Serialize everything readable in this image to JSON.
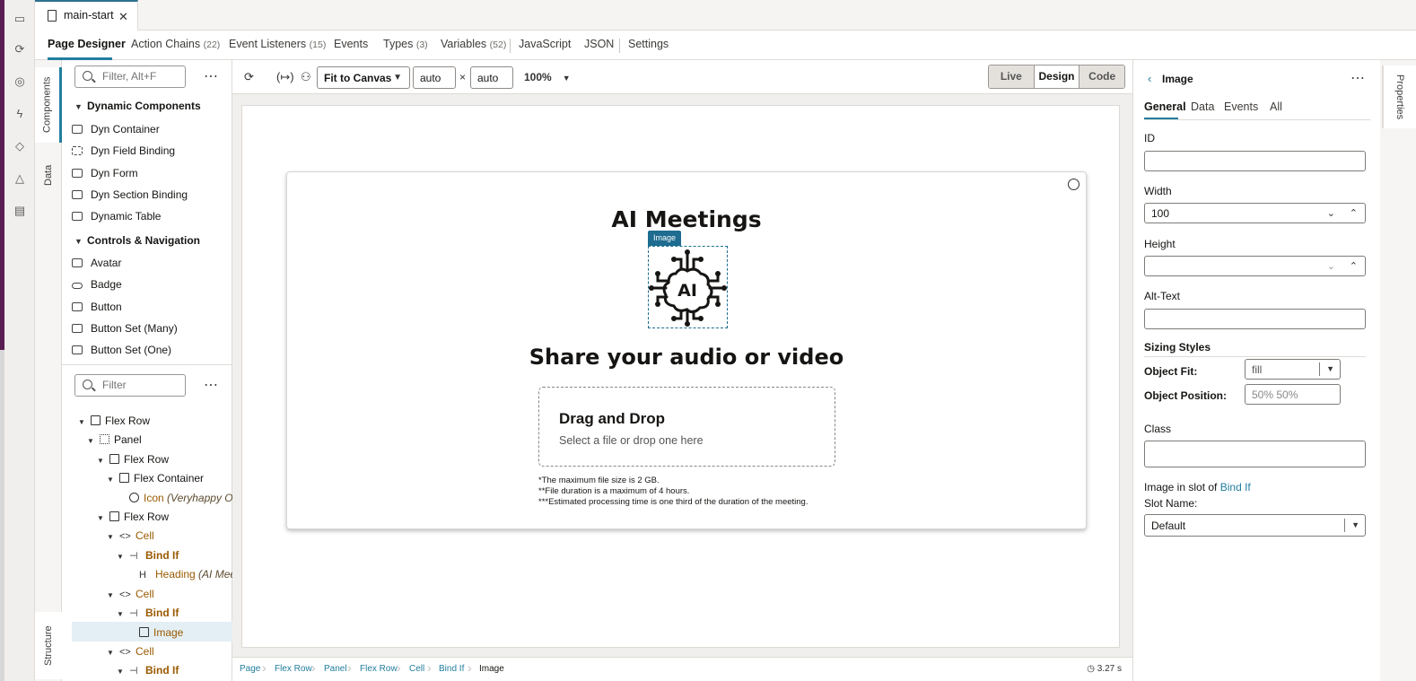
{
  "file_tab": {
    "name": "main-start"
  },
  "nav_tabs": [
    {
      "label": "Page Designer",
      "count": ""
    },
    {
      "label": "Action Chains",
      "count": "(22)"
    },
    {
      "label": "Event Listeners",
      "count": "(15)"
    },
    {
      "label": "Events",
      "count": ""
    },
    {
      "label": "Types",
      "count": "(3)"
    },
    {
      "label": "Variables",
      "count": "(52)"
    },
    {
      "label": "JavaScript",
      "count": ""
    },
    {
      "label": "JSON",
      "count": ""
    },
    {
      "label": "Settings",
      "count": ""
    }
  ],
  "left_tabs": {
    "components": "Components",
    "data": "Data",
    "structure": "Structure"
  },
  "components": {
    "filter_placeholder": "Filter, Alt+F",
    "groups": [
      {
        "title": "Dynamic Components",
        "items": [
          "Dyn Container",
          "Dyn Field Binding",
          "Dyn Form",
          "Dyn Section Binding",
          "Dynamic Table"
        ]
      },
      {
        "title": "Controls & Navigation",
        "items": [
          "Avatar",
          "Badge",
          "Button",
          "Button Set (Many)",
          "Button Set (One)"
        ]
      }
    ]
  },
  "structure": {
    "filter_placeholder": "Filter",
    "nodes": [
      {
        "label": "Flex Row",
        "sub": ""
      },
      {
        "label": "Panel",
        "sub": ""
      },
      {
        "label": "Flex Row",
        "sub": ""
      },
      {
        "label": "Flex Container",
        "sub": ""
      },
      {
        "label": "Icon",
        "sub": "(Veryhappy Ou"
      },
      {
        "label": "Flex Row",
        "sub": ""
      },
      {
        "label": "Cell",
        "sub": ""
      },
      {
        "label": "Bind If",
        "sub": ""
      },
      {
        "label": "Heading",
        "sub": "(AI Meet"
      },
      {
        "label": "Cell",
        "sub": ""
      },
      {
        "label": "Bind If",
        "sub": ""
      },
      {
        "label": "Image",
        "sub": ""
      },
      {
        "label": "Cell",
        "sub": ""
      },
      {
        "label": "Bind If",
        "sub": ""
      }
    ]
  },
  "toolbar": {
    "fit": "Fit to Canvas",
    "width": "auto",
    "times": "×",
    "height": "auto",
    "zoom": "100%",
    "modes": [
      "Live",
      "Design",
      "Code"
    ]
  },
  "canvas": {
    "title": "AI Meetings",
    "image_badge": "Image",
    "image_text": "AI",
    "share": "Share your audio or video",
    "drop_title": "Drag and Drop",
    "drop_sub": "Select a file or drop one here",
    "notes": [
      "*The maximum file size is 2 GB.",
      "**File duration is a maximum of 4 hours.",
      "***Estimated processing time is one third of the duration of the meeting."
    ]
  },
  "breadcrumb": [
    "Page",
    "Flex Row",
    "Panel",
    "Flex Row",
    "Cell",
    "Bind If",
    "Image"
  ],
  "timer": "3.27 s",
  "properties": {
    "vertical_tab": "Properties",
    "title": "Image",
    "tabs": [
      "General",
      "Data",
      "Events",
      "All"
    ],
    "id_label": "ID",
    "id_value": "",
    "width_label": "Width",
    "width_value": "100",
    "height_label": "Height",
    "height_value": "",
    "alt_label": "Alt-Text",
    "alt_value": "",
    "sizing_label": "Sizing Styles",
    "fit_label": "Object Fit:",
    "fit_value": "fill",
    "position_label": "Object Position:",
    "position_placeholder": "50% 50%",
    "class_label": "Class",
    "class_value": "",
    "slot_text": "Image in slot of",
    "slot_link": "Bind If",
    "slot_name_label": "Slot Name:",
    "slot_name_value": "Default"
  },
  "colors": {
    "accent": "#227e9e",
    "selection": "#1e6c8f",
    "desktop": "#5a1f52"
  }
}
